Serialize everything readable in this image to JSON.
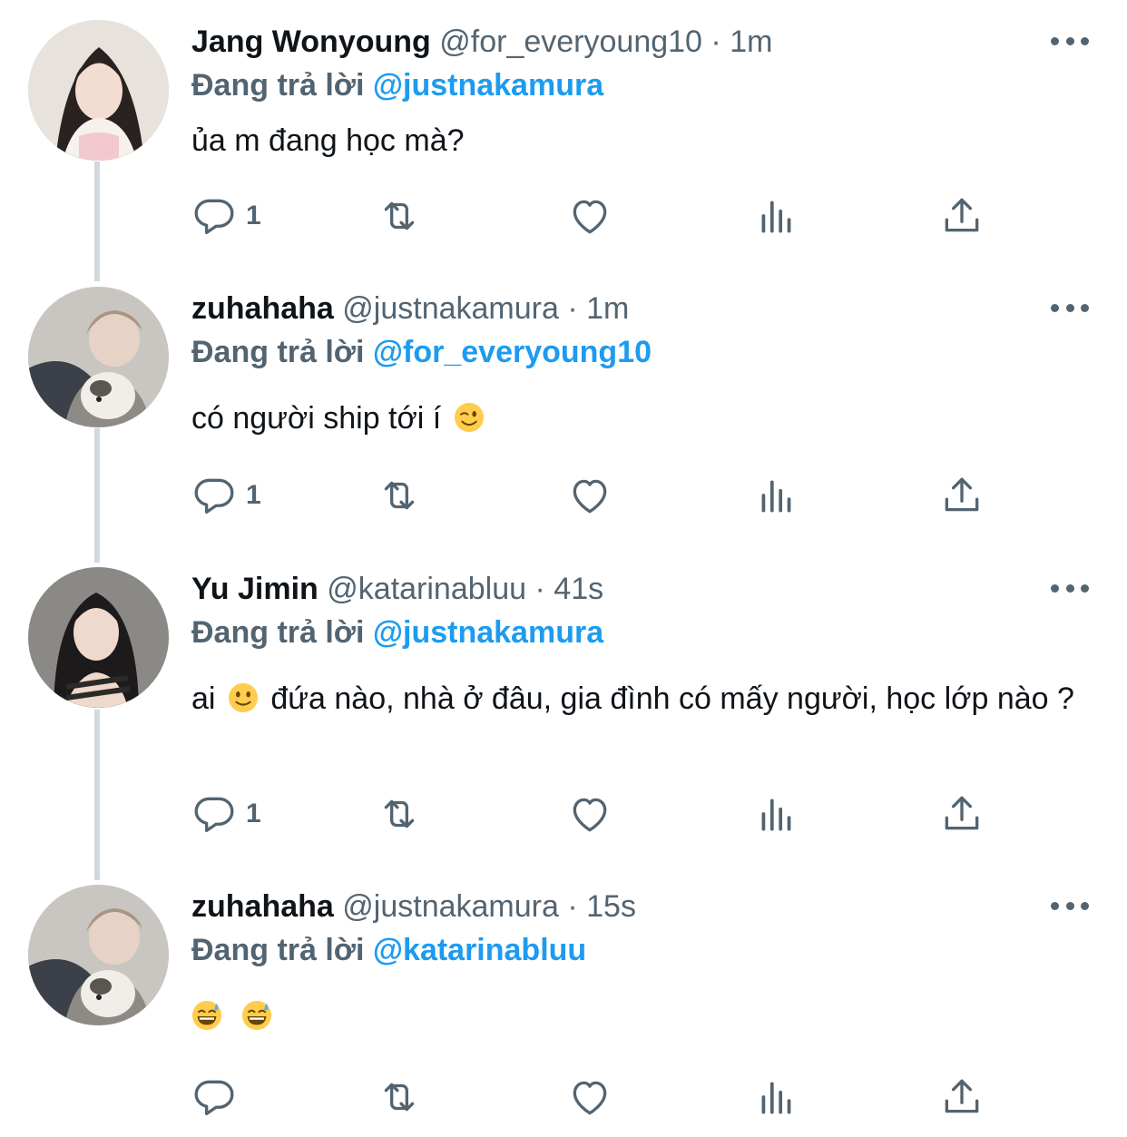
{
  "tweets": [
    {
      "name": "Jang Wonyoung",
      "handle": "@for_everyoung10",
      "sep": "·",
      "time": "1m",
      "replying_prefix": "Đang trả lời",
      "replying_to": "@justnakamura",
      "text": "ủa m đang học mà?",
      "reply_count": "1"
    },
    {
      "name": "zuhahaha",
      "handle": "@justnakamura",
      "sep": "·",
      "time": "1m",
      "replying_prefix": "Đang trả lời",
      "replying_to": "@for_everyoung10",
      "text": "có người ship tới í",
      "emoji": "winking-face",
      "reply_count": "1"
    },
    {
      "name": "Yu Jimin",
      "handle": "@katarinabluu",
      "sep": "·",
      "time": "41s",
      "replying_prefix": "Đang trả lời",
      "replying_to": "@justnakamura",
      "text_a": "ai",
      "emoji": "slightly-smiling-face",
      "text_b": "đứa nào, nhà ở đâu, gia đình có mấy người, học lớp nào ?",
      "reply_count": "1"
    },
    {
      "name": "zuhahaha",
      "handle": "@justnakamura",
      "sep": "·",
      "time": "15s",
      "replying_prefix": "Đang trả lời",
      "replying_to": "@katarinabluu",
      "emojis": [
        "grinning-face-with-sweat",
        "grinning-face-with-sweat"
      ],
      "reply_count": ""
    }
  ],
  "icons": {
    "reply": "reply-icon",
    "retweet": "retweet-icon",
    "like": "like-icon",
    "views": "views-icon",
    "share": "share-icon",
    "more": "more-icon"
  },
  "colors": {
    "text": "#0f1419",
    "secondary": "#536471",
    "link": "#1d9bf0",
    "thread_line": "#cfd9de"
  }
}
